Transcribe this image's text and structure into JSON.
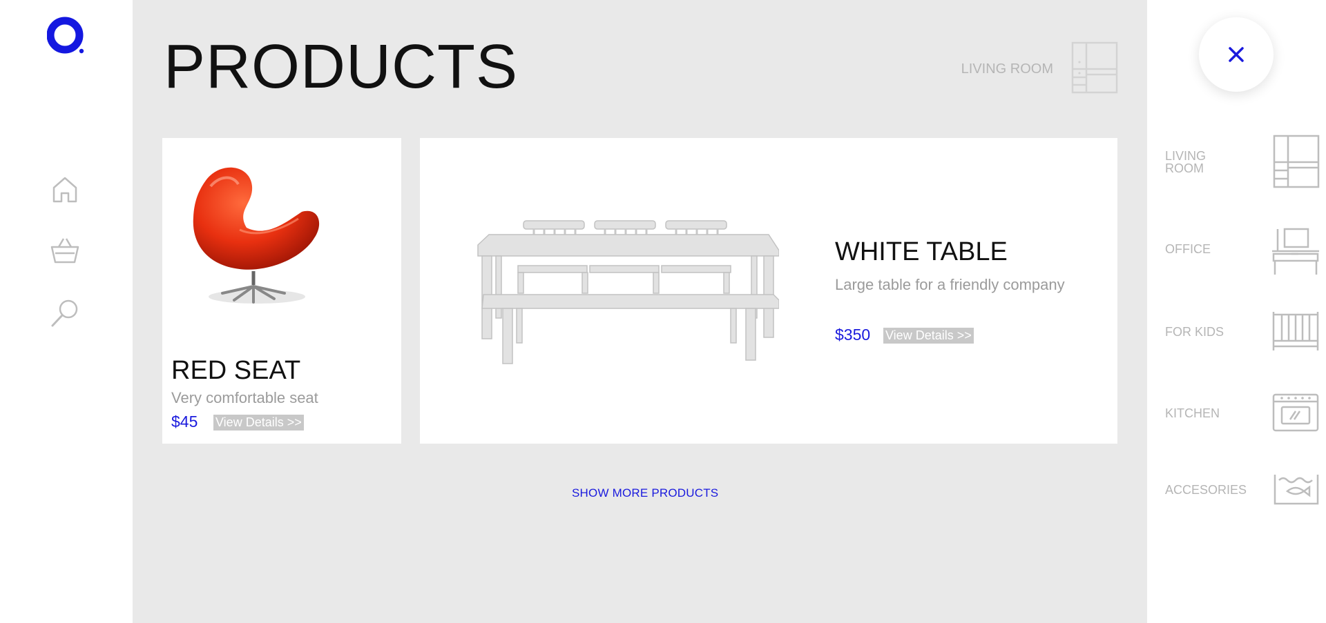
{
  "page": {
    "title": "PRODUCTS",
    "current_category": "LIVING ROOM",
    "show_more": "SHOW MORE PRODUCTS"
  },
  "products": [
    {
      "name": "RED SEAT",
      "description": "Very comfortable seat",
      "price": "$45",
      "details_label": "View Details >>",
      "image": "red-egg-chair"
    },
    {
      "name": "WHITE TABLE",
      "description": "Large table for a friendly company",
      "price": "$350",
      "details_label": "View Details >>",
      "image": "white-table-with-chairs"
    }
  ],
  "left_nav": {
    "logo": "brand-logo",
    "items": [
      {
        "icon": "home-icon"
      },
      {
        "icon": "basket-icon"
      },
      {
        "icon": "search-icon"
      }
    ]
  },
  "category_menu": {
    "close_icon": "close-icon",
    "items": [
      {
        "label": "LIVING ROOM",
        "icon": "cabinet-icon"
      },
      {
        "label": "OFFICE",
        "icon": "desk-icon"
      },
      {
        "label": "FOR KIDS",
        "icon": "crib-icon"
      },
      {
        "label": "KITCHEN",
        "icon": "stove-icon"
      },
      {
        "label": "ACCESORIES",
        "icon": "aquarium-icon"
      }
    ]
  },
  "colors": {
    "accent": "#1a1add",
    "panel_bg": "#e9e9e9",
    "muted_text": "#b5b5b5",
    "button_bg": "#c8c8c8"
  }
}
